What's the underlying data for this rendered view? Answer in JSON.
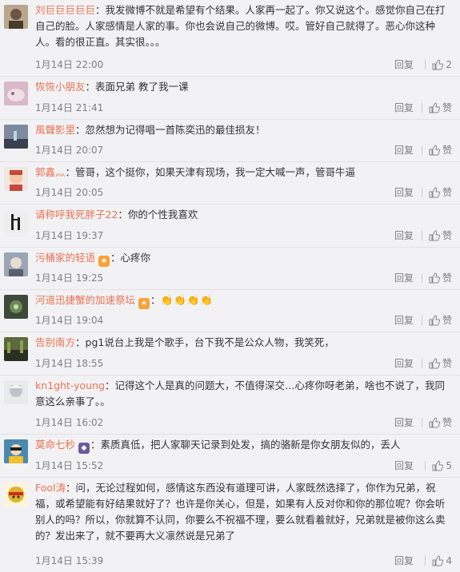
{
  "comments": [
    {
      "user": "刘巨巨巨巨巨",
      "sep": "：",
      "text": "我发微博不就是希望有个结果。人家再一起了。你又说这个。感觉你自己在打自己的脸。人家感情是人家的事。你也会说自己的微博。哎。管好自己就得了。恶心你这种人。看的很正直。其实很。。。",
      "time": "1月14日 22:00",
      "reply": "回复",
      "likes": "2",
      "avatar_color": "#b9a68f"
    },
    {
      "user": "恢恢小朋友",
      "sep": "：",
      "text": "表面兄弟 教了我一课",
      "time": "1月14日 21:41",
      "reply": "回复",
      "likes": "赞",
      "avatar_color": "#d9b8c8"
    },
    {
      "user": "風聲影里",
      "sep": "：",
      "text": "忽然想为记得唱一首陈奕迅的最佳损友！",
      "time": "1月14日 20:07",
      "reply": "回复",
      "likes": "赞",
      "avatar_color": "#7d8aa0"
    },
    {
      "user": "郭鑫灬",
      "sep": "：",
      "text": "管哥，这个挺你，如果天津有现场，我一定大喊一声，管哥牛逼",
      "time": "1月14日 20:05",
      "reply": "回复",
      "likes": "赞",
      "avatar_color": "#c8463c"
    },
    {
      "user": "请称呼我死胖子22",
      "sep": "：",
      "text": "你的个性我喜欢",
      "time": "1月14日 19:37",
      "reply": "回复",
      "likes": "赞",
      "avatar_color": "#eeeeee"
    },
    {
      "user": "污桶家的轻语",
      "sep": "：",
      "text": "心疼你",
      "time": "1月14日 19:25",
      "reply": "回复",
      "likes": "赞",
      "avatar_color": "#9aa5b5",
      "badge": "orange"
    },
    {
      "user": "河道迅捷蟹的加速祭坛",
      "sep": "：",
      "text": "👏👏👏👏",
      "time": "1月14日 19:04",
      "reply": "回复",
      "likes": "赞",
      "avatar_color": "#3d4a3a",
      "badge": "orange"
    },
    {
      "user": "告别南方",
      "sep": "：",
      "text": "pg1说台上我是个歌手，台下我不是公众人物，我笑死，",
      "time": "1月14日 18:55",
      "reply": "回复",
      "likes": "赞",
      "avatar_color": "#5a6a3a"
    },
    {
      "user": "kn1ght-young",
      "sep": "：",
      "text": "记得这个人是真的问题大，不值得深交…心疼你呀老弟，啥也不说了，我同意这么亲事了。。",
      "time": "1月14日 16:02",
      "reply": "回复",
      "likes": "赞",
      "avatar_color": "#c0c4c8"
    },
    {
      "user": "莫命七秒",
      "sep": "：",
      "text": "素质真低，把人家聊天记录到处发，搞的骆新是你女朋友似的，丢人",
      "time": "1月14日 15:52",
      "reply": "回复",
      "likes": "5",
      "avatar_color": "#4a8ab0",
      "badge": "purple"
    },
    {
      "user": "Fool涛",
      "sep": "：",
      "text": "问，无论过程如何，感情这东西没有道理可讲，人家既然选择了，你作为兄弟，祝福，或希望能有好结果就好了？也许是你关心，但是，如果有人反对你和你的那位呢？你会听别人的吗？所以，你就算不认同，你要么不祝福不理，要么就看着就好，兄弟就是被你这么卖的？发出来了，就不要再大义凛然说是兄弟了",
      "time": "1月14日 15:39",
      "reply": "回复",
      "likes": "4",
      "avatar_color": "#e0b030"
    }
  ],
  "colors": {
    "username": "#eb7350",
    "text": "#333333",
    "meta": "#808080",
    "background": "#f2f2f5"
  },
  "icons": {
    "like": "thumbs-up-icon",
    "badge": "vip-badge-icon"
  }
}
